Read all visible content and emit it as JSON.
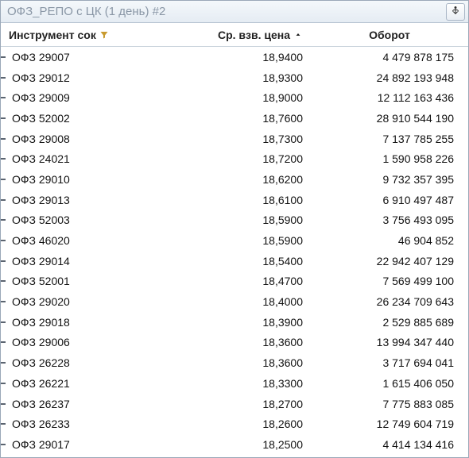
{
  "window": {
    "title": "ОФЗ_РЕПО с ЦК (1 день) #2"
  },
  "columns": {
    "instrument": "Инструмент сок",
    "price": "Ср. взв. цена",
    "turnover": "Оборот"
  },
  "rows": [
    {
      "instr": "ОФЗ 29007",
      "price": "18,9400",
      "turn": "4 479 878 175"
    },
    {
      "instr": "ОФЗ 29012",
      "price": "18,9300",
      "turn": "24 892 193 948"
    },
    {
      "instr": "ОФЗ 29009",
      "price": "18,9000",
      "turn": "12 112 163 436"
    },
    {
      "instr": "ОФЗ 52002",
      "price": "18,7600",
      "turn": "28 910 544 190"
    },
    {
      "instr": "ОФЗ 29008",
      "price": "18,7300",
      "turn": "7 137 785 255"
    },
    {
      "instr": "ОФЗ 24021",
      "price": "18,7200",
      "turn": "1 590 958 226"
    },
    {
      "instr": "ОФЗ 29010",
      "price": "18,6200",
      "turn": "9 732 357 395"
    },
    {
      "instr": "ОФЗ 29013",
      "price": "18,6100",
      "turn": "6 910 497 487"
    },
    {
      "instr": "ОФЗ 52003",
      "price": "18,5900",
      "turn": "3 756 493 095"
    },
    {
      "instr": "ОФЗ 46020",
      "price": "18,5900",
      "turn": "46 904 852"
    },
    {
      "instr": "ОФЗ 29014",
      "price": "18,5400",
      "turn": "22 942 407 129"
    },
    {
      "instr": "ОФЗ 52001",
      "price": "18,4700",
      "turn": "7 569 499 100"
    },
    {
      "instr": "ОФЗ 29020",
      "price": "18,4000",
      "turn": "26 234 709 643"
    },
    {
      "instr": "ОФЗ 29018",
      "price": "18,3900",
      "turn": "2 529 885 689"
    },
    {
      "instr": "ОФЗ 29006",
      "price": "18,3600",
      "turn": "13 994 347 440"
    },
    {
      "instr": "ОФЗ 26228",
      "price": "18,3600",
      "turn": "3 717 694 041"
    },
    {
      "instr": "ОФЗ 26221",
      "price": "18,3300",
      "turn": "1 615 406 050"
    },
    {
      "instr": "ОФЗ 26237",
      "price": "18,2700",
      "turn": "7 775 883 085"
    },
    {
      "instr": "ОФЗ 26233",
      "price": "18,2600",
      "turn": "12 749 604 719"
    },
    {
      "instr": "ОФЗ 29017",
      "price": "18,2500",
      "turn": "4 414 134 416"
    }
  ]
}
